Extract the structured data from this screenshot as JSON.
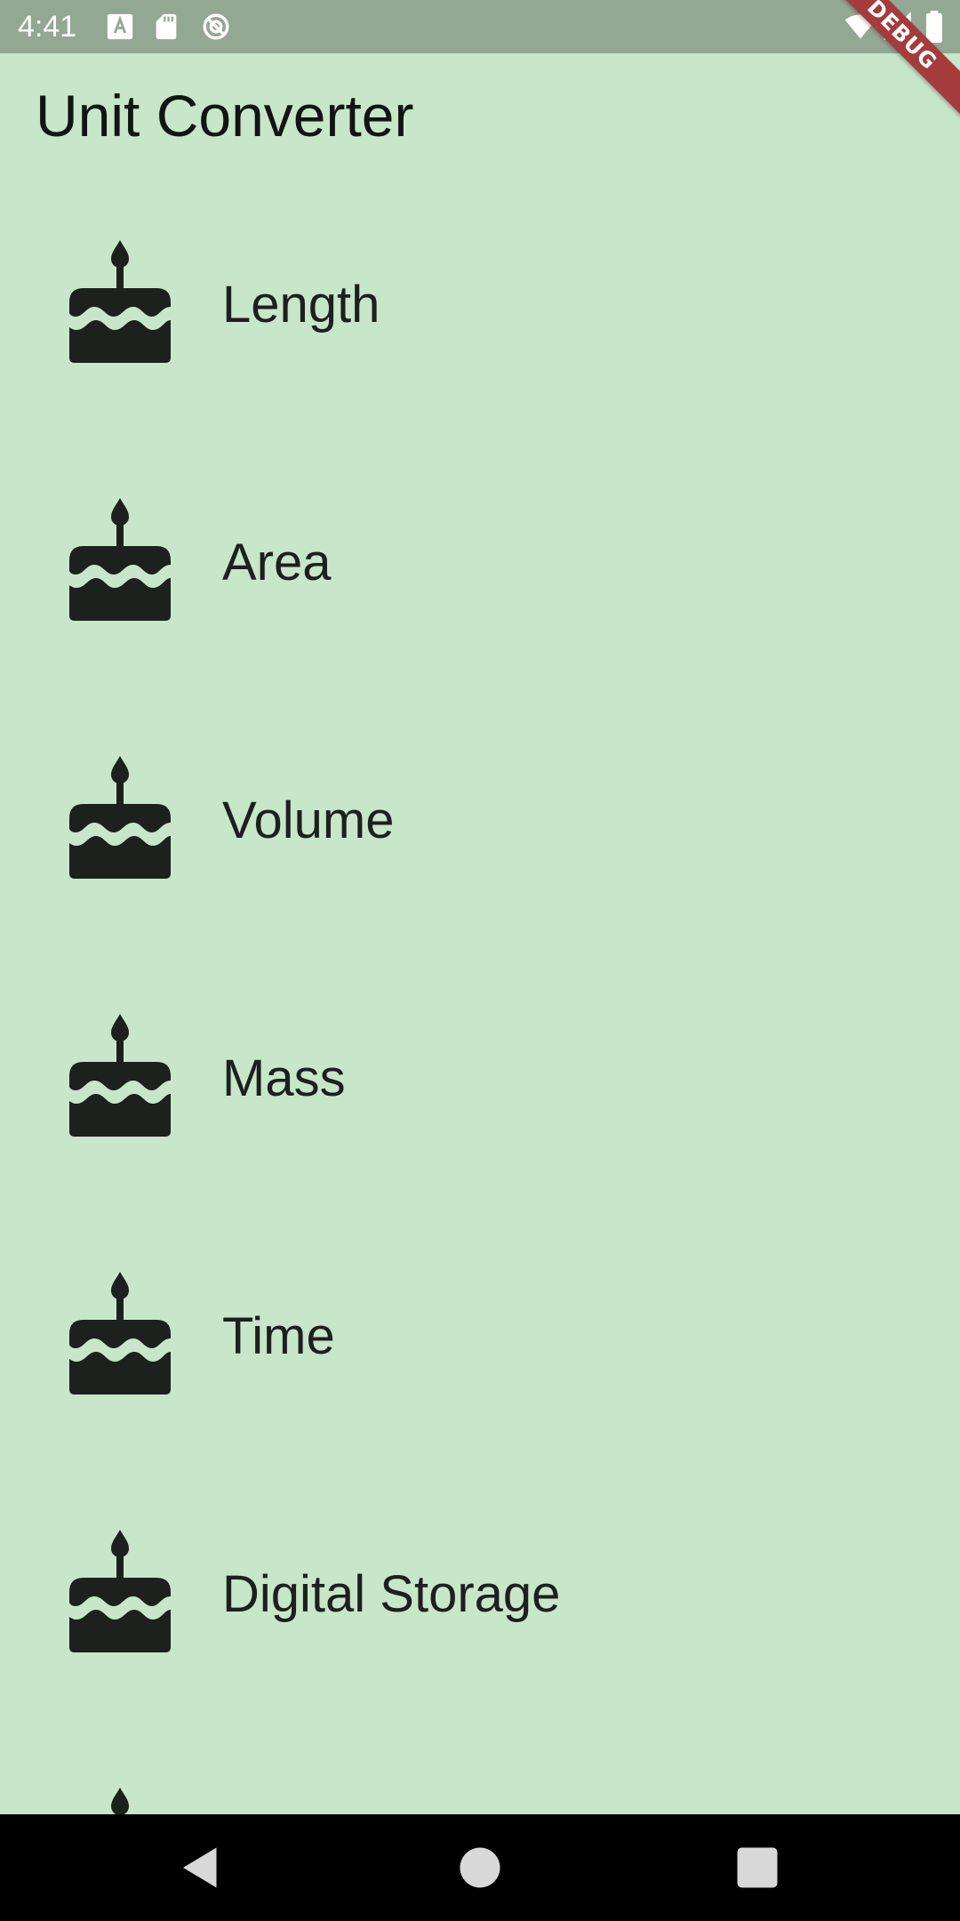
{
  "status_bar": {
    "time": "4:41",
    "icons_left": [
      "font-a-icon",
      "sd-card-icon",
      "sync-disabled-icon"
    ],
    "icons_right": [
      "wifi-icon",
      "signal-icon",
      "battery-icon"
    ]
  },
  "debug_banner": {
    "label": "DEBUG"
  },
  "app_bar": {
    "title": "Unit Converter"
  },
  "categories": [
    {
      "label": "Length",
      "icon": "cake-icon"
    },
    {
      "label": "Area",
      "icon": "cake-icon"
    },
    {
      "label": "Volume",
      "icon": "cake-icon"
    },
    {
      "label": "Mass",
      "icon": "cake-icon"
    },
    {
      "label": "Time",
      "icon": "cake-icon"
    },
    {
      "label": "Digital Storage",
      "icon": "cake-icon"
    },
    {
      "label": "",
      "icon": "cake-icon"
    }
  ],
  "nav_bar": {
    "buttons": [
      "back-icon",
      "home-icon",
      "recents-icon"
    ]
  },
  "colors": {
    "background": "#c8e6c9",
    "status_bar": "#93a893",
    "text": "#1c211d",
    "icon": "#1c211d",
    "debug_ribbon": "#a53b3b",
    "nav_bar": "#000000"
  }
}
